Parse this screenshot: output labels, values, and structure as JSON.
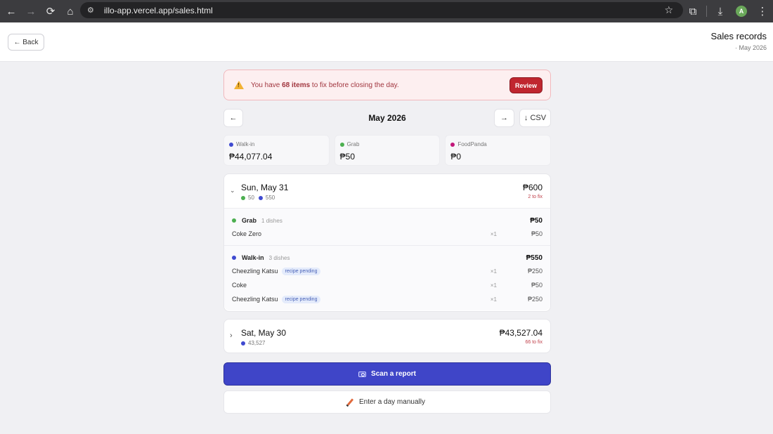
{
  "browser": {
    "url": "illo-app.vercel.app/sales.html",
    "profile_initial": "A",
    "icons": {
      "back": "arrow-left-icon",
      "forward": "arrow-right-icon",
      "reload": "reload-icon",
      "home": "home-icon"
    }
  },
  "header": {
    "back_label": "← Back",
    "title": "Sales records",
    "subtitle": "· May 2026"
  },
  "alert": {
    "prefix": "You have ",
    "count": "68 items",
    "suffix": " to fix before closing the day.",
    "button": "Review",
    "color": "#c0262f"
  },
  "month_nav": {
    "prev": "←",
    "label": "May 2026",
    "next": "→",
    "csv": "↓ CSV"
  },
  "channels": [
    {
      "name": "Walk-in",
      "total": "₱44,077.04",
      "color": "#3f4ad0"
    },
    {
      "name": "Grab",
      "total": "₱50",
      "color": "#4caf50"
    },
    {
      "name": "FoodPanda",
      "total": "₱0",
      "color": "#c2187a"
    }
  ],
  "days": [
    {
      "chevron": "⌄",
      "title": "Sun, May 31",
      "total": "₱600",
      "fix": "2 to fix",
      "chips": [
        "50",
        "550"
      ],
      "groups": [
        {
          "channel": "Grab",
          "count": "1 dishes",
          "amount": "₱50",
          "items": [
            {
              "name": "Coke Zero",
              "tag": "",
              "qty": "×1",
              "price": "₱50"
            }
          ]
        },
        {
          "channel": "Walk-in",
          "count": "3 dishes",
          "amount": "₱550",
          "items": [
            {
              "name": "Cheezling Katsu",
              "tag": "recipe pending",
              "qty": "×1",
              "price": "₱250"
            },
            {
              "name": "Coke",
              "tag": "",
              "qty": "×1",
              "price": "₱50"
            },
            {
              "name": "Cheezling Katsu",
              "tag": "recipe pending",
              "qty": "×1",
              "price": "₱250"
            }
          ]
        }
      ]
    },
    {
      "chevron": "›",
      "title": "Sat, May 30",
      "total": "₱43,527.04",
      "fix": "66 to fix",
      "chips": [
        "43,527"
      ]
    }
  ],
  "actions": {
    "scan": "Scan a report",
    "manual": "Enter a day manually"
  }
}
